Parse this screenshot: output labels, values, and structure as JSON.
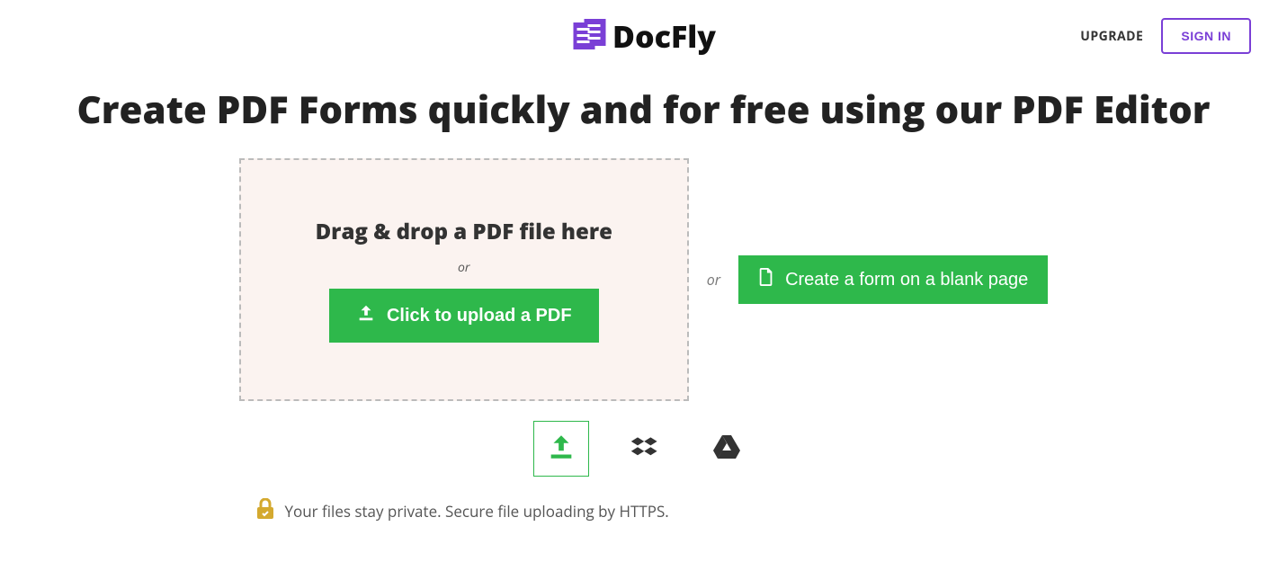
{
  "header": {
    "brand_name": "DocFly",
    "upgrade_label": "UPGRADE",
    "signin_label": "SIGN IN"
  },
  "hero": {
    "title": "Create PDF Forms quickly and for free using our PDF Editor"
  },
  "dropzone": {
    "drag_title": "Drag & drop a PDF file here",
    "or_text": "or",
    "upload_button_label": "Click to upload a PDF"
  },
  "mid": {
    "or_text": "or"
  },
  "blank": {
    "button_label": "Create a form on a blank page"
  },
  "sources": {
    "computer_name": "computer-upload",
    "dropbox_name": "dropbox",
    "gdrive_name": "google-drive"
  },
  "secure": {
    "message": "Your files stay private. Secure file uploading by HTTPS."
  },
  "colors": {
    "accent_purple": "#7a3fd6",
    "accent_green": "#2eb84b",
    "gold": "#d4a92f"
  }
}
